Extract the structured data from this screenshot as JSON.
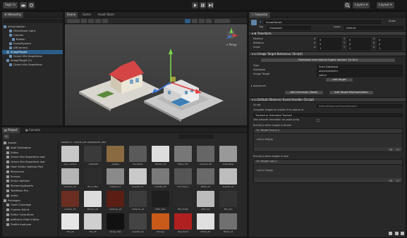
{
  "toolbar": {
    "account_label": "Sign in",
    "cloud_icon": "cloud-icon",
    "search_icon": "search-icon",
    "layers_label": "Layers",
    "layout_label": "Layout"
  },
  "hierarchy": {
    "tab": "Hierarchy",
    "items": [
      {
        "label": "Arfoundation",
        "indent": 0,
        "selected": false
      },
      {
        "label": "Directional Light",
        "indent": 2,
        "selected": false
      },
      {
        "label": "Canvas",
        "indent": 2,
        "selected": false
      },
      {
        "label": "Button",
        "indent": 3,
        "selected": false
      },
      {
        "label": "EventSystem",
        "indent": 2,
        "selected": false
      },
      {
        "label": "ARCamera",
        "indent": 2,
        "selected": false
      },
      {
        "label": "ImageTarget",
        "indent": 1,
        "selected": true
      },
      {
        "label": "Grand Vila Sepahtera",
        "indent": 2,
        "selected": false
      },
      {
        "label": "ImageTarget (1)",
        "indent": 1,
        "selected": false
      },
      {
        "label": "Grand Vila Sepahtera",
        "indent": 2,
        "selected": false
      }
    ]
  },
  "scene": {
    "tabs": [
      "Scene",
      "Game",
      "Asset Store"
    ],
    "persp_label": "< Persp"
  },
  "inspector": {
    "tab": "Inspector",
    "object_name": "ImageTarget",
    "static_label": "Static",
    "tag_label": "Tag",
    "tag_value": "Untagged",
    "layer_label": "Layer",
    "layer_value": "Default",
    "transform_header": "Transform",
    "position_label": "Position",
    "rotation_label": "Rotation",
    "scale_label": "Scale",
    "position": {
      "x": "0",
      "y": "0",
      "z": "0"
    },
    "rotation": {
      "x": "0",
      "y": "0",
      "z": "0"
    },
    "scale": {
      "x": "1",
      "y": "1",
      "z": "1"
    },
    "itb_header": "Image Target Behaviour (Script)",
    "download_label": "Download new Vuforia Engine version: 10.18.4",
    "type_label": "Type",
    "type_value": "From Database",
    "database_label": "Database",
    "database_value": "aipecendestiny",
    "image_target_label": "Image Target",
    "image_target_value": "sabrin",
    "add_target_button": "Add Target",
    "advanced_label": "Advanced",
    "add_occlusion_button": "Add Occlusion (Mask)",
    "add_target_rep_button": "Add Target Representation",
    "deh_header": "Default Observer Event Handler (Script)",
    "script_label": "Script",
    "script_value": "DefaultObserverEventHandler",
    "consider_label": "Consider target as visible if its status is:",
    "consider_value": "Tracked or Extended Tracked",
    "smooth_label": "Use smooth transition on pose jump",
    "event_found_label": "Event(s) when target is found:",
    "on_found_label": "On Target Found ()",
    "list_empty_1": "List is Empty",
    "event_lost_label": "Event(s) when target is lost:",
    "on_lost_label": "On Target Lost ()",
    "list_empty_2": "List is Empty"
  },
  "project": {
    "tabs": [
      "Project",
      "Console"
    ],
    "breadcrumb": "Assets > Grand Vila Sepahtera last",
    "tree": [
      {
        "label": "Assets",
        "indent": 0
      },
      {
        "label": "Aset Tambahan",
        "indent": 1
      },
      {
        "label": "Editor",
        "indent": 1
      },
      {
        "label": "Grand Vila Sepahtera last",
        "indent": 1
      },
      {
        "label": "Grand Vila Sepahtera last",
        "indent": 1
      },
      {
        "label": "Hash Editor Aplikasi Pad",
        "indent": 1
      },
      {
        "label": "Resources",
        "indent": 1
      },
      {
        "label": "Scenes",
        "indent": 1
      },
      {
        "label": "Script Aplikasi",
        "indent": 1
      },
      {
        "label": "StreamingAssets",
        "indent": 1
      },
      {
        "label": "TextMesh Pro",
        "indent": 1
      },
      {
        "label": "video",
        "indent": 1
      },
      {
        "label": "Packages",
        "indent": 0
      },
      {
        "label": "Code Coverage",
        "indent": 1
      },
      {
        "label": "Custom NUnit",
        "indent": 1
      },
      {
        "label": "Editor Coroutines",
        "indent": 1
      },
      {
        "label": "JetBrains Rider Editor",
        "indent": 1
      },
      {
        "label": "Profile Analyzer",
        "indent": 1
      }
    ],
    "assets_row1": [
      "pop_models",
      "_1008286",
      "_plaster",
      "blocktext",
      "Marble_01",
      "Metal_Tile",
      "Campos_Pb",
      "Gritplaster"
    ],
    "assets_row2": [
      "Ceramic_01",
      "Brick_Wal",
      "Cobble_01",
      "Granite_01",
      "Granite_02",
      "Concrete_1",
      "Metal_03",
      "Asphalt_01"
    ],
    "assets_row3": [
      "Leather_01",
      "Marble_02",
      "material_01",
      "material_02",
      "MD2_tiles",
      "MD_Polish",
      "MD2_Pol",
      "MD_Pad"
    ],
    "assets_row4": [
      "Tile_04",
      "Tile_05",
      "Stripe_Wal",
      "Asphalt_02",
      "Orange",
      "Red_Paint",
      "White_Bri",
      "Metal_04"
    ]
  },
  "colors": {
    "accent": "#2c5d87",
    "panel": "#282828",
    "scene_bg": "#3a3a3a"
  }
}
